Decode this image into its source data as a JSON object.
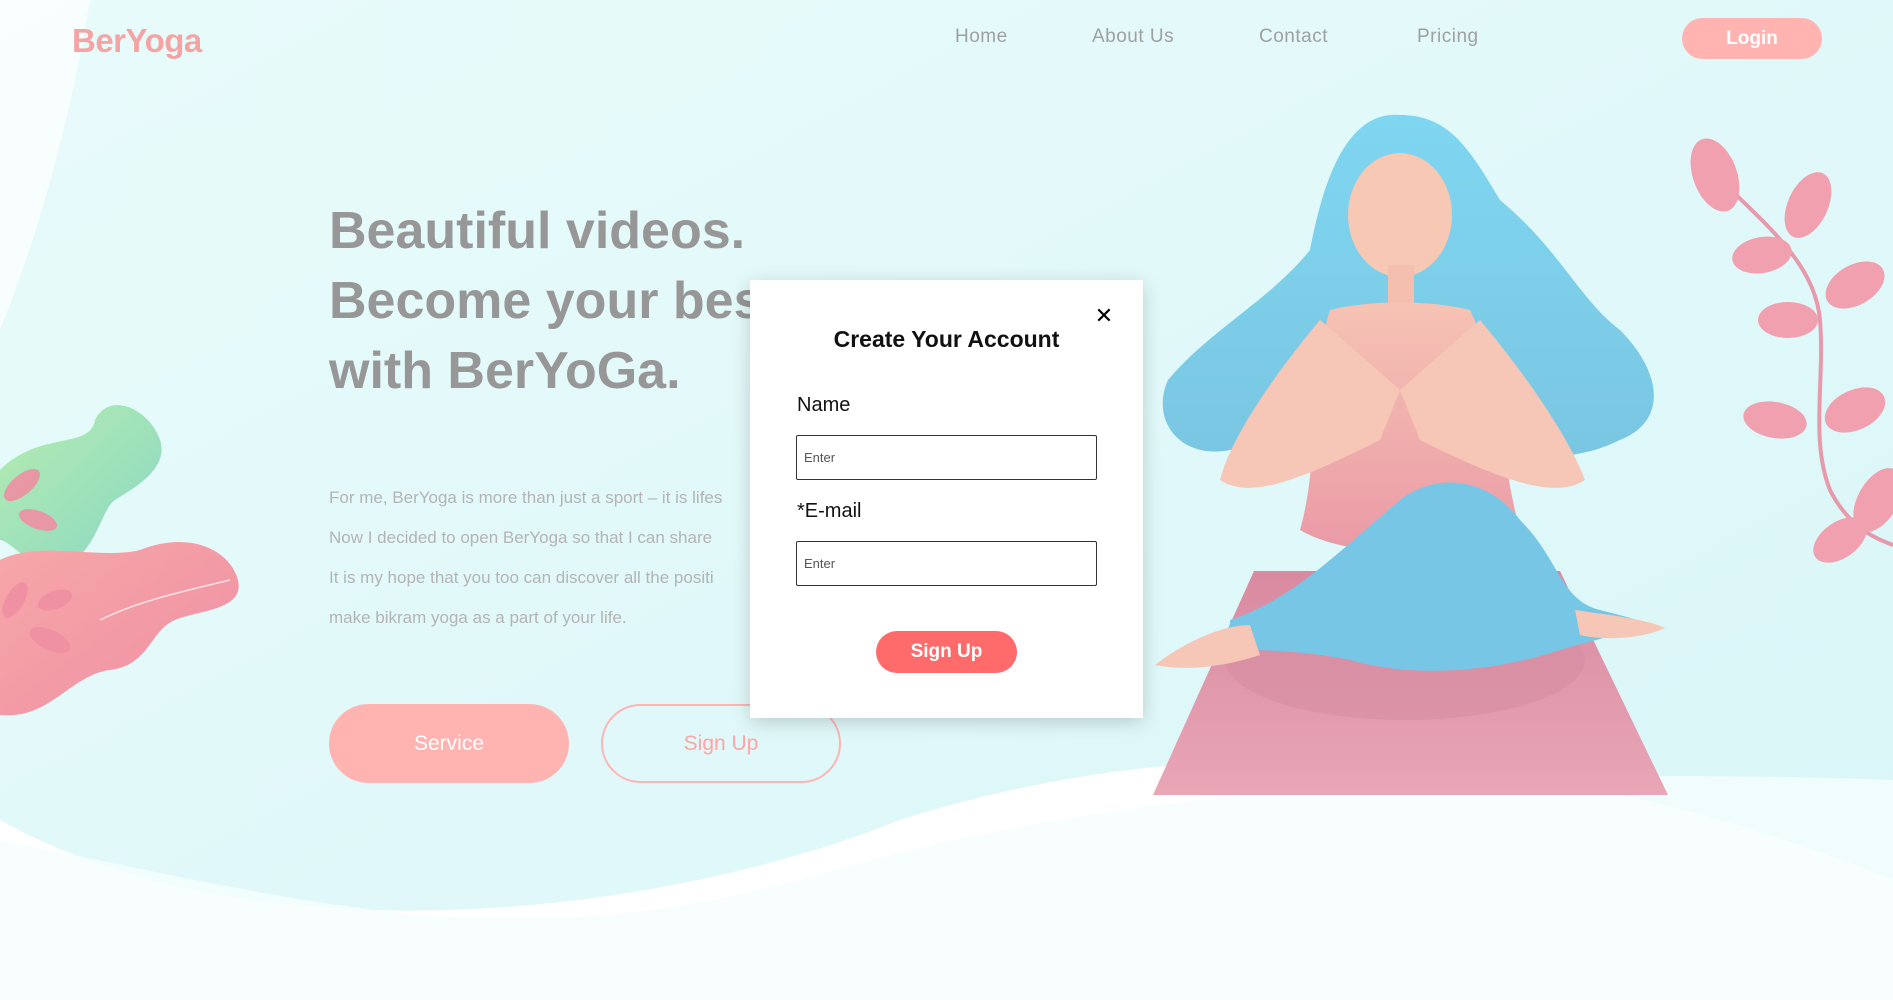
{
  "brand": {
    "logo_text": "BerYoga"
  },
  "nav": {
    "items": [
      "Home",
      "About Us",
      "Contact",
      "Pricing"
    ],
    "login_label": "Login"
  },
  "hero": {
    "title_lines": [
      "Beautiful videos.",
      "Become your best",
      "with BerYoGa."
    ],
    "text_lines": [
      "For me, BerYoga is more than just a sport – it is lifes",
      "Now I decided to open BerYoga so that I can share",
      "It is my hope that you too can discover all the positi",
      "make bikram yoga as a part of your life."
    ],
    "service_label": "Service",
    "signup_label": "Sign Up"
  },
  "modal": {
    "title": "Create Your Account",
    "close_glyph": "✕",
    "name_label": "Name",
    "name_placeholder": "Enter",
    "email_label": "*E-mail",
    "email_placeholder": "Enter",
    "submit_label": "Sign Up"
  },
  "colors": {
    "brand_pink": "#f5a3a3",
    "button_pink": "#ffb4b2",
    "submit_red": "#ff6a6a",
    "background": "#e6fbfb",
    "hair_blue": "#7fd3ee",
    "mat_pink": "#e09aac"
  }
}
